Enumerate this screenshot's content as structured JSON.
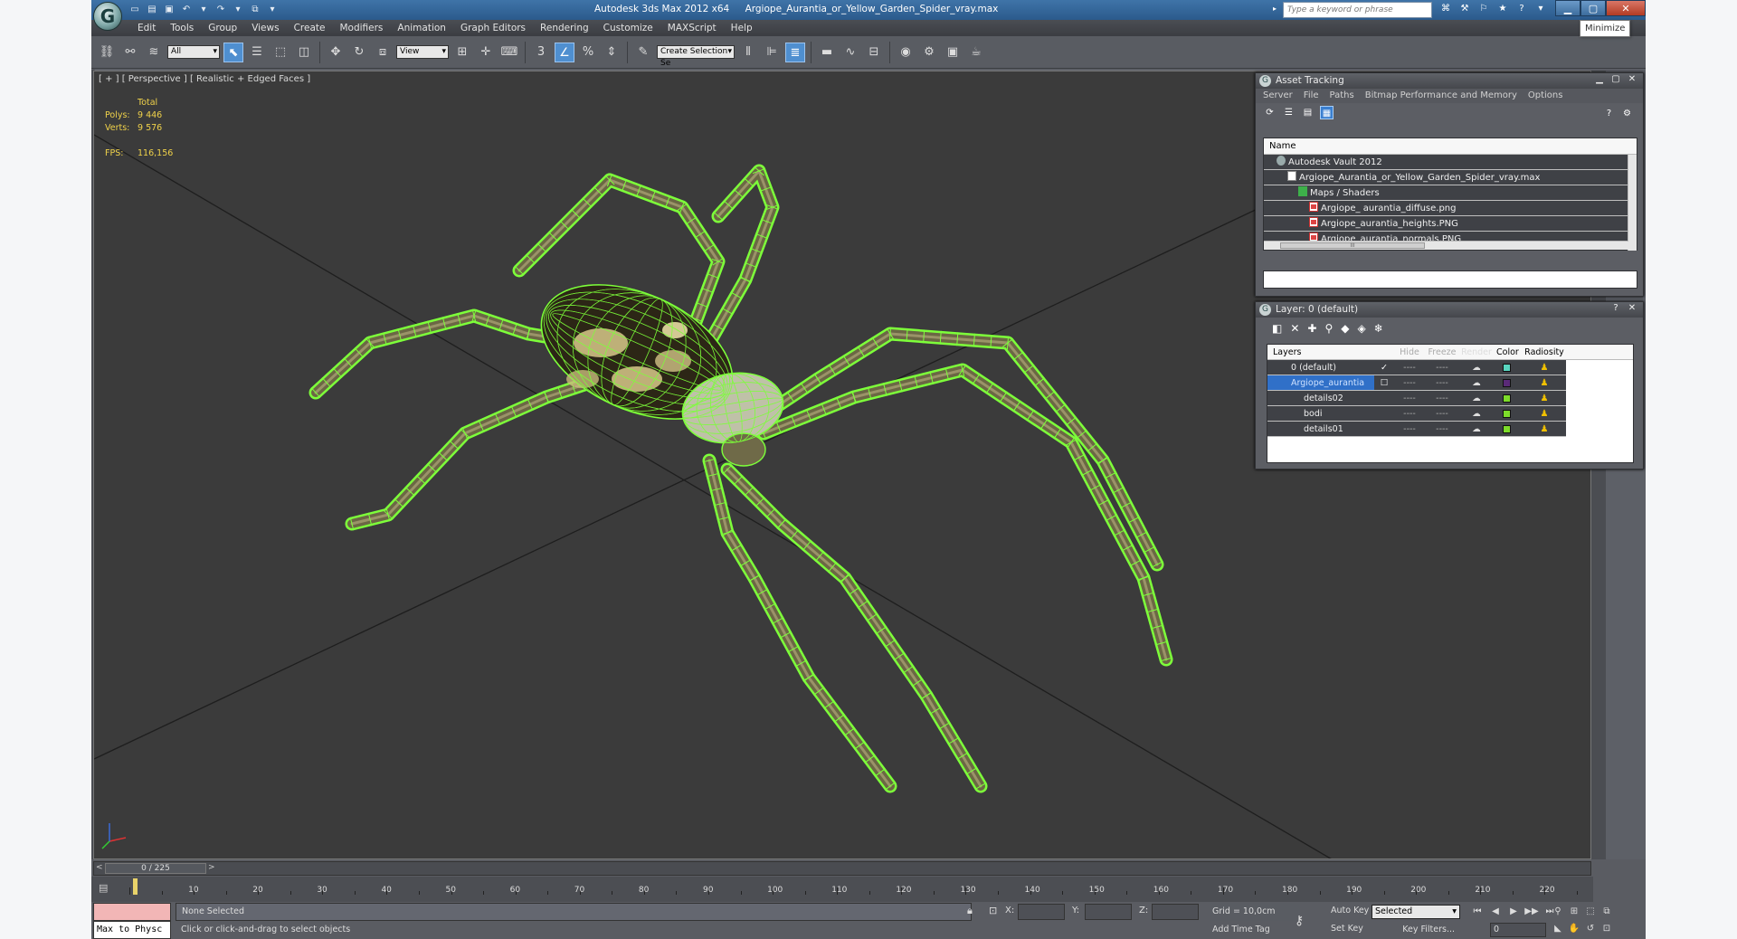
{
  "window": {
    "app_name": "Autodesk 3ds Max  2012 x64",
    "file_name": "Argiope_Aurantia_or_Yellow_Garden_Spider_vray.max",
    "search_placeholder": "Type a keyword or phrase",
    "tooltip": "Minimize",
    "logo_glyph": "G"
  },
  "menu": [
    "Edit",
    "Tools",
    "Group",
    "Views",
    "Create",
    "Modifiers",
    "Animation",
    "Graph Editors",
    "Rendering",
    "Customize",
    "MAXScript",
    "Help"
  ],
  "toolbar": {
    "selection_filter": "All",
    "reference_coord": "View",
    "named_selection": "Create Selection Se",
    "snap_label": "3",
    "percent_snap": "%"
  },
  "viewport": {
    "label": "[ + ] [ Perspective ] [ Realistic + Edged Faces ]",
    "stats": {
      "total_label": "Total",
      "polys_label": "Polys:",
      "polys_value": "9 446",
      "verts_label": "Verts:",
      "verts_value": "9 576",
      "fps_label": "FPS:",
      "fps_value": "116,156"
    }
  },
  "asset_tracking": {
    "title": "Asset Tracking",
    "menu": [
      "Server",
      "File",
      "Paths",
      "Bitmap Performance and Memory",
      "Options"
    ],
    "column_header": "Name",
    "rows": [
      {
        "label": "Autodesk Vault 2012",
        "indent": 0,
        "icon": "vault-icon"
      },
      {
        "label": "Argiope_Aurantia_or_Yellow_Garden_Spider_vray.max",
        "indent": 1,
        "icon": "file-icon"
      },
      {
        "label": "Maps / Shaders",
        "indent": 2,
        "icon": "folder-icon"
      },
      {
        "label": "Argiope_ aurantia_diffuse.png",
        "indent": 3,
        "icon": "image-file-icon"
      },
      {
        "label": "Argiope_aurantia_heights.PNG",
        "indent": 3,
        "icon": "image-file-icon"
      },
      {
        "label": "Argiope_aurantia_normals.PNG",
        "indent": 3,
        "icon": "image-file-icon"
      }
    ],
    "scroll_thumb_label": "III"
  },
  "layer_manager": {
    "title": "Layer: 0 (default)",
    "columns": {
      "layers": "Layers",
      "hide": "Hide",
      "freeze": "Freeze",
      "render": "Render",
      "color": "Color",
      "radiosity": "Radiosity"
    },
    "rows": [
      {
        "name": "0 (default)",
        "active": "✓",
        "selected": false,
        "hide": "----",
        "freeze": "----",
        "render": "☁",
        "color": "#59d6c0",
        "radiosity": "♟"
      },
      {
        "name": "Argiope_aurantia",
        "active": "☐",
        "selected": true,
        "hide": "----",
        "freeze": "----",
        "render": "☁",
        "color": "#5a2a78",
        "radiosity": "♟"
      },
      {
        "name": "details02",
        "active": "",
        "selected": false,
        "hide": "----",
        "freeze": "----",
        "render": "☁",
        "color": "#7ddc2a",
        "radiosity": "♟"
      },
      {
        "name": "bodi",
        "active": "",
        "selected": false,
        "hide": "----",
        "freeze": "----",
        "render": "☁",
        "color": "#7ddc2a",
        "radiosity": "♟"
      },
      {
        "name": "details01",
        "active": "",
        "selected": false,
        "hide": "----",
        "freeze": "----",
        "render": "☁",
        "color": "#7ddc2a",
        "radiosity": "♟"
      }
    ]
  },
  "timeline": {
    "frame_display": "0 / 225",
    "ticks": [
      10,
      20,
      30,
      40,
      50,
      60,
      70,
      80,
      90,
      100,
      110,
      120,
      130,
      140,
      150,
      160,
      170,
      180,
      190,
      200,
      210,
      220
    ],
    "frame_total": 225
  },
  "status": {
    "maxscript_label": "Max to Physc",
    "selection": "None Selected",
    "prompt": "Click or click-and-drag to select objects",
    "x_label": "X:",
    "y_label": "Y:",
    "z_label": "Z:",
    "grid": "Grid = 10,0cm",
    "add_time_tag": "Add Time Tag",
    "auto_key": "Auto Key",
    "set_key": "Set Key",
    "key_mode": "Selected",
    "key_filters": "Key Filters...",
    "current_frame": "0"
  },
  "colors": {
    "wireframe": "#7dff3a",
    "viewport_bg": "#3b3b3b",
    "stats_text": "#f0d24a",
    "selection_blue": "#3070c8"
  }
}
